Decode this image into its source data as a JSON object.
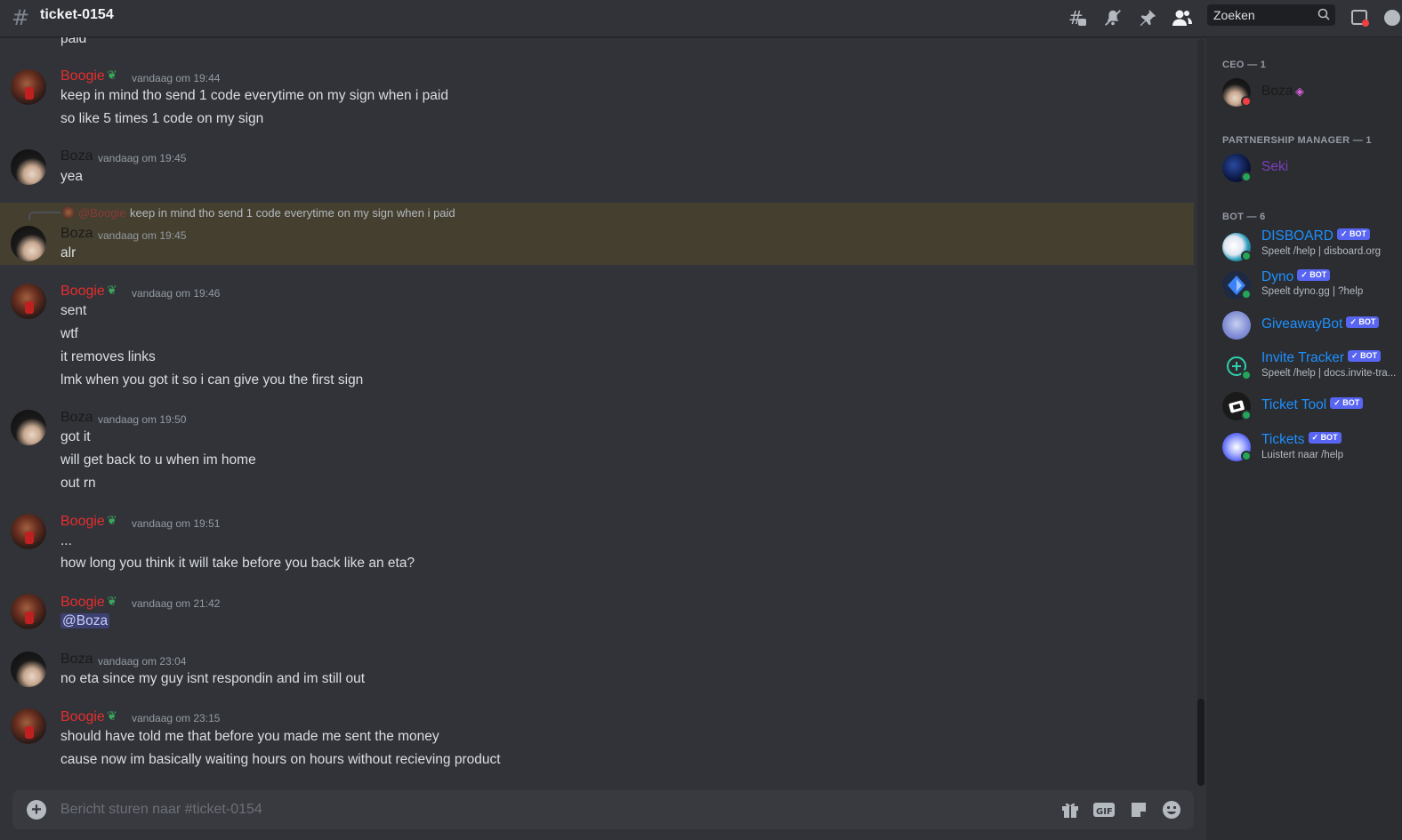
{
  "header": {
    "channel_name": "ticket-0154",
    "search_placeholder": "Zoeken"
  },
  "chat": {
    "top_partial": "paid",
    "reply": {
      "mention": "@Boogie",
      "text": "keep in mind tho send 1 code everytime on my sign when i paid"
    },
    "messages": [
      {
        "author": "Boogie",
        "time": "vandaag om 19:44",
        "lines": [
          "keep in mind tho send 1 code everytime on my sign when i paid",
          "so like 5 times 1 code on my sign"
        ]
      },
      {
        "author": "Boza",
        "time": "vandaag om 19:45",
        "lines": [
          "yea"
        ]
      },
      {
        "author": "Boza",
        "time": "vandaag om 19:45",
        "lines": [
          "alr"
        ]
      },
      {
        "author": "Boogie",
        "time": "vandaag om 19:46",
        "lines": [
          "sent",
          "wtf",
          "it removes links",
          "lmk when you got it so i can give you the first sign"
        ]
      },
      {
        "author": "Boza",
        "time": "vandaag om 19:50",
        "lines": [
          "got it",
          "will get back to u when im home",
          "out rn"
        ]
      },
      {
        "author": "Boogie",
        "time": "vandaag om 19:51",
        "lines": [
          "...",
          "how long you think it will take before you back like an eta?"
        ]
      },
      {
        "author": "Boogie",
        "time": "vandaag om 21:42",
        "lines": [
          "@Boza"
        ]
      },
      {
        "author": "Boza",
        "time": "vandaag om 23:04",
        "lines": [
          "no eta since my guy isnt respondin and im still out"
        ]
      },
      {
        "author": "Boogie",
        "time": "vandaag om 23:15",
        "lines": [
          "should have told me that before you made me sent the money",
          "cause now im basically waiting hours on hours without recieving product"
        ]
      }
    ]
  },
  "composer": {
    "placeholder": "Bericht sturen naar #ticket-0154",
    "gif_label": "GIF"
  },
  "members": {
    "categories": [
      {
        "label": "CEO — 1"
      },
      {
        "label": "PARTNERSHIP MANAGER — 1"
      },
      {
        "label": "BOT — 6"
      }
    ],
    "list": [
      {
        "name": "Boza",
        "sub": "",
        "color": "#1a1a1a"
      },
      {
        "name": "Seki",
        "sub": "",
        "color": "#7b3fbf"
      },
      {
        "name": "DISBOARD",
        "sub": "Speelt /help | disboard.org",
        "color": "#1e90ff"
      },
      {
        "name": "Dyno",
        "sub": "Speelt dyno.gg | ?help",
        "color": "#1e90ff"
      },
      {
        "name": "GiveawayBot",
        "sub": "",
        "color": "#1e90ff"
      },
      {
        "name": "Invite Tracker",
        "sub": "Speelt /help | docs.invite-tra...",
        "color": "#1e90ff"
      },
      {
        "name": "Ticket Tool",
        "sub": "",
        "color": "#1e90ff"
      },
      {
        "name": "Tickets",
        "sub": "Luistert naar /help",
        "color": "#1e90ff"
      }
    ],
    "bot_tag": "BOT"
  },
  "colors": {
    "boogie": "#e62e2e",
    "boza": "#1a1a1a",
    "seki": "#7b3fbf",
    "bot_name": "#1e90ff",
    "bot_tag": "#5865f2",
    "online": "#23a55a",
    "dnd": "#f23f43"
  }
}
